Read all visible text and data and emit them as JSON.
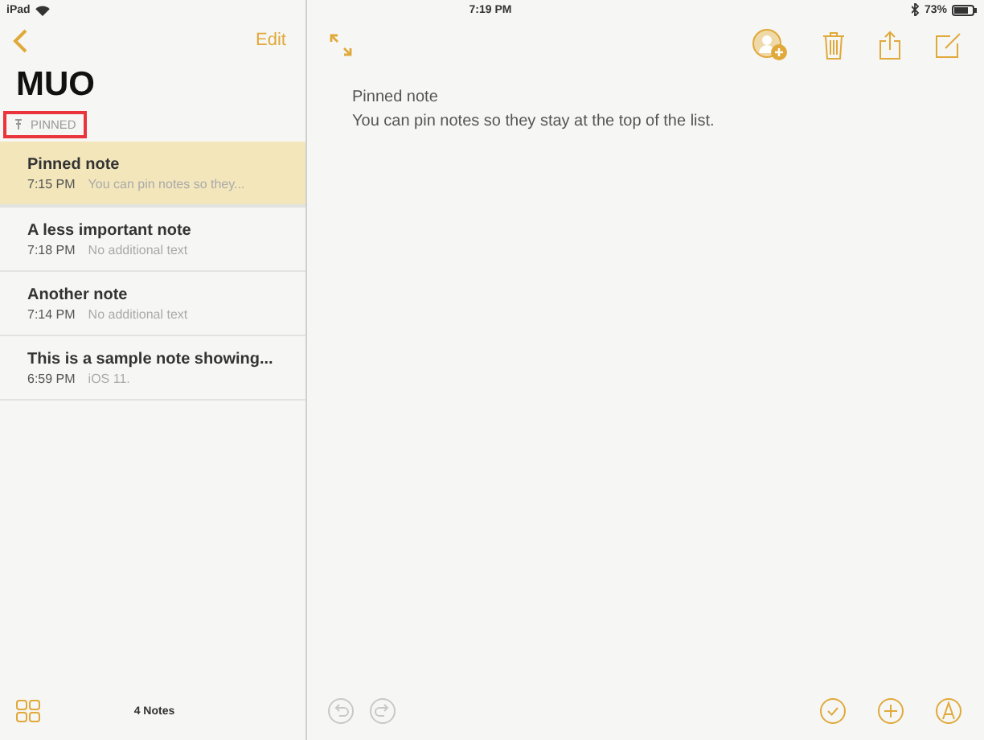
{
  "status_bar": {
    "device": "iPad",
    "time": "7:19 PM",
    "battery": "73%"
  },
  "sidebar": {
    "edit": "Edit",
    "title": "MUO",
    "section": {
      "label": "PINNED",
      "highlighted": true
    },
    "notes": [
      {
        "title": "Pinned note",
        "time": "7:15 PM",
        "preview": "You can pin notes so they...",
        "selected": true
      },
      {
        "title": "A less important note",
        "time": "7:18 PM",
        "preview": "No additional text",
        "selected": false
      },
      {
        "title": "Another note",
        "time": "7:14 PM",
        "preview": "No additional text",
        "selected": false
      },
      {
        "title": "This is a sample note showing...",
        "time": "6:59 PM",
        "preview": "iOS 11.",
        "selected": false
      }
    ],
    "count": "4 Notes"
  },
  "editor": {
    "top_tools": [
      {
        "kind": "add-person"
      },
      {
        "kind": "trash"
      },
      {
        "kind": "share"
      },
      {
        "kind": "compose"
      }
    ],
    "lines": [
      "Pinned note",
      "You can pin notes so they stay at the top of the list."
    ],
    "bottom_left": [
      {
        "kind": "undo",
        "disabled": true
      },
      {
        "kind": "redo",
        "disabled": true
      }
    ],
    "bottom_right": [
      {
        "kind": "checklist",
        "disabled": false
      },
      {
        "kind": "add",
        "disabled": false
      },
      {
        "kind": "sketch",
        "disabled": false
      }
    ]
  }
}
